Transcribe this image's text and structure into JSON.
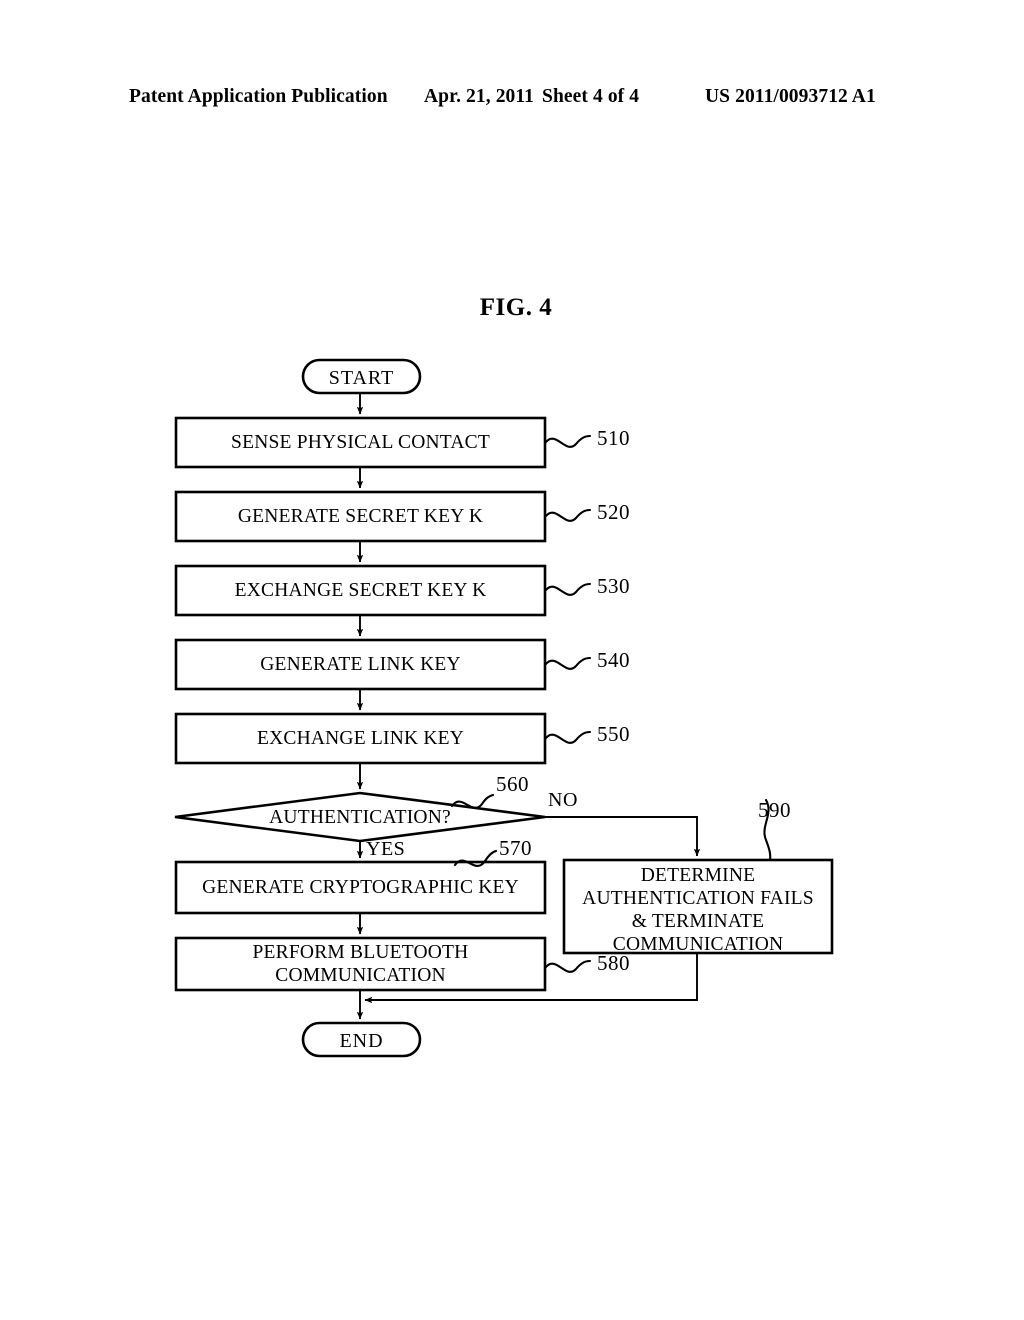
{
  "header": {
    "left": "Patent Application Publication",
    "date": "Apr. 21, 2011",
    "sheet": "Sheet 4 of 4",
    "publication_number": "US 2011/0093712 A1"
  },
  "figure": {
    "title": "FIG. 4",
    "type": "flowchart"
  },
  "flowchart": {
    "nodes": [
      {
        "id": "start",
        "shape": "terminator",
        "label": "START",
        "ref": null
      },
      {
        "id": "n510",
        "shape": "process",
        "label": "SENSE PHYSICAL CONTACT",
        "ref": "510"
      },
      {
        "id": "n520",
        "shape": "process",
        "label": "GENERATE SECRET KEY K",
        "ref": "520"
      },
      {
        "id": "n530",
        "shape": "process",
        "label": "EXCHANGE SECRET KEY K",
        "ref": "530"
      },
      {
        "id": "n540",
        "shape": "process",
        "label": "GENERATE LINK KEY",
        "ref": "540"
      },
      {
        "id": "n550",
        "shape": "process",
        "label": "EXCHANGE LINK KEY",
        "ref": "550"
      },
      {
        "id": "n560",
        "shape": "decision",
        "label": "AUTHENTICATION?",
        "ref": "560"
      },
      {
        "id": "n570",
        "shape": "process",
        "label": "GENERATE CRYPTOGRAPHIC KEY",
        "ref": "570"
      },
      {
        "id": "n580",
        "shape": "process",
        "label": "PERFORM BLUETOOTH\nCOMMUNICATION",
        "ref": "580"
      },
      {
        "id": "n590",
        "shape": "process",
        "label": "DETERMINE\nAUTHENTICATION FAILS\n& TERMINATE\nCOMMUNICATION",
        "ref": "590"
      },
      {
        "id": "end",
        "shape": "terminator",
        "label": "END",
        "ref": null
      }
    ],
    "branch_labels": {
      "yes": "YES",
      "no": "NO"
    },
    "edges": [
      {
        "from": "start",
        "to": "n510",
        "label": ""
      },
      {
        "from": "n510",
        "to": "n520",
        "label": ""
      },
      {
        "from": "n520",
        "to": "n530",
        "label": ""
      },
      {
        "from": "n530",
        "to": "n540",
        "label": ""
      },
      {
        "from": "n540",
        "to": "n550",
        "label": ""
      },
      {
        "from": "n550",
        "to": "n560",
        "label": ""
      },
      {
        "from": "n560",
        "to": "n570",
        "label": "YES"
      },
      {
        "from": "n560",
        "to": "n590",
        "label": "NO"
      },
      {
        "from": "n570",
        "to": "n580",
        "label": ""
      },
      {
        "from": "n580",
        "to": "end",
        "label": ""
      },
      {
        "from": "n590",
        "to": "end",
        "label": ""
      }
    ]
  },
  "colors": {
    "ink": "#000000",
    "paper": "#ffffff"
  }
}
